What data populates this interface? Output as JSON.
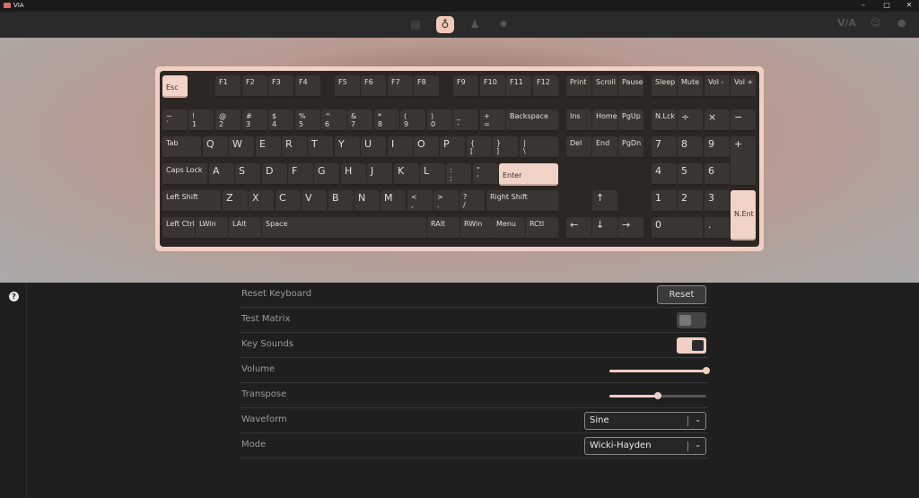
{
  "window": {
    "title": "VIA",
    "minimize": "–",
    "maximize": "□",
    "close": "✕"
  },
  "nav": {
    "icons": [
      "keyboard-icon",
      "stethoscope-icon",
      "design-icon",
      "gear-icon"
    ],
    "right": {
      "via_logo": "V/A",
      "discord": "☺",
      "github": "●"
    }
  },
  "colors": {
    "accent": "#f1cfc3",
    "keycap": "#3a3533",
    "board": "#2c2624"
  },
  "keyboard": {
    "keys": [
      [
        "esc",
        "Esc",
        "",
        181,
        84,
        28,
        25,
        true,
        false
      ],
      [
        "f1",
        "F1",
        "",
        240,
        84,
        28,
        25,
        false,
        false
      ],
      [
        "f2",
        "F2",
        "",
        270,
        84,
        28,
        25,
        false,
        false
      ],
      [
        "f3",
        "F3",
        "",
        299,
        84,
        28,
        25,
        false,
        false
      ],
      [
        "f4",
        "F4",
        "",
        329,
        84,
        28,
        25,
        false,
        false
      ],
      [
        "f5",
        "F5",
        "",
        373,
        84,
        28,
        25,
        false,
        false
      ],
      [
        "f6",
        "F6",
        "",
        402,
        84,
        28,
        25,
        false,
        false
      ],
      [
        "f7",
        "F7",
        "",
        432,
        84,
        28,
        25,
        false,
        false
      ],
      [
        "f8",
        "F8",
        "",
        461,
        84,
        28,
        25,
        false,
        false
      ],
      [
        "f9",
        "F9",
        "",
        505,
        84,
        28,
        25,
        false,
        false
      ],
      [
        "f10",
        "F10",
        "",
        535,
        84,
        28,
        25,
        false,
        false
      ],
      [
        "f11",
        "F11",
        "",
        564,
        84,
        28,
        25,
        false,
        false
      ],
      [
        "f12",
        "F12",
        "",
        594,
        84,
        28,
        25,
        false,
        false
      ],
      [
        "print",
        "Print",
        "",
        631,
        84,
        28,
        25,
        false,
        false
      ],
      [
        "scroll",
        "Scroll",
        "",
        660,
        84,
        28,
        25,
        false,
        false
      ],
      [
        "pause",
        "Pause",
        "",
        689,
        84,
        28,
        25,
        false,
        false
      ],
      [
        "sleep",
        "Sleep",
        "",
        726,
        84,
        28,
        25,
        false,
        false
      ],
      [
        "mute",
        "Mute",
        "",
        755,
        84,
        28,
        25,
        false,
        false
      ],
      [
        "vol-down",
        "Vol -",
        "",
        785,
        84,
        28,
        25,
        false,
        false
      ],
      [
        "vol-up",
        "Vol +",
        "",
        814,
        84,
        28,
        25,
        false,
        false
      ],
      [
        "grave",
        "~",
        "`",
        181,
        122,
        28,
        25,
        false,
        false
      ],
      [
        "1",
        "!",
        "1",
        210,
        122,
        28,
        25,
        false,
        false
      ],
      [
        "2",
        "@",
        "2",
        240,
        122,
        28,
        25,
        false,
        false
      ],
      [
        "3",
        "#",
        "3",
        270,
        122,
        28,
        25,
        false,
        false
      ],
      [
        "4",
        "$",
        "4",
        299,
        122,
        28,
        25,
        false,
        false
      ],
      [
        "5",
        "%",
        "5",
        329,
        122,
        28,
        25,
        false,
        false
      ],
      [
        "6",
        "^",
        "6",
        358,
        122,
        28,
        25,
        false,
        false
      ],
      [
        "7",
        "&",
        "7",
        387,
        122,
        28,
        25,
        false,
        false
      ],
      [
        "8",
        "*",
        "8",
        417,
        122,
        28,
        25,
        false,
        false
      ],
      [
        "9",
        "(",
        "9",
        446,
        122,
        28,
        25,
        false,
        false
      ],
      [
        "0",
        ")",
        "0",
        476,
        122,
        28,
        25,
        false,
        false
      ],
      [
        "minus",
        "_",
        "-",
        505,
        122,
        28,
        25,
        false,
        false
      ],
      [
        "equal",
        "+",
        "=",
        535,
        122,
        28,
        25,
        false,
        false
      ],
      [
        "backspace",
        "Backspace",
        "",
        564,
        122,
        58,
        25,
        false,
        false
      ],
      [
        "ins",
        "Ins",
        "",
        631,
        122,
        28,
        25,
        false,
        false
      ],
      [
        "home",
        "Home",
        "",
        660,
        122,
        28,
        25,
        false,
        false
      ],
      [
        "pgup",
        "PgUp",
        "",
        689,
        122,
        28,
        25,
        false,
        false
      ],
      [
        "numlock",
        "N.Lck",
        "",
        726,
        122,
        28,
        25,
        false,
        false
      ],
      [
        "num-div",
        "÷",
        "",
        755,
        122,
        28,
        25,
        false,
        true
      ],
      [
        "num-mul",
        "×",
        "",
        785,
        122,
        28,
        25,
        false,
        true
      ],
      [
        "num-sub",
        "−",
        "",
        814,
        122,
        28,
        25,
        false,
        true
      ],
      [
        "tab",
        "Tab",
        "",
        181,
        152,
        43,
        25,
        false,
        false
      ],
      [
        "q",
        "Q",
        "",
        226,
        152,
        28,
        25,
        false,
        true
      ],
      [
        "w",
        "W",
        "",
        255,
        152,
        28,
        25,
        false,
        true
      ],
      [
        "e",
        "E",
        "",
        285,
        152,
        28,
        25,
        false,
        true
      ],
      [
        "r",
        "R",
        "",
        314,
        152,
        28,
        25,
        false,
        true
      ],
      [
        "t",
        "T",
        "",
        343,
        152,
        28,
        25,
        false,
        true
      ],
      [
        "y",
        "Y",
        "",
        373,
        152,
        28,
        25,
        false,
        true
      ],
      [
        "u",
        "U",
        "",
        402,
        152,
        28,
        25,
        false,
        true
      ],
      [
        "i",
        "I",
        "",
        432,
        152,
        28,
        25,
        false,
        true
      ],
      [
        "o",
        "O",
        "",
        461,
        152,
        28,
        25,
        false,
        true
      ],
      [
        "p",
        "P",
        "",
        490,
        152,
        28,
        25,
        false,
        true
      ],
      [
        "lbracket",
        "{",
        "[",
        520,
        152,
        28,
        25,
        false,
        false
      ],
      [
        "rbracket",
        "}",
        "]",
        549,
        152,
        28,
        25,
        false,
        false
      ],
      [
        "backslash",
        "|",
        "\\",
        579,
        152,
        43,
        25,
        false,
        false
      ],
      [
        "del",
        "Del",
        "",
        631,
        152,
        28,
        25,
        false,
        false
      ],
      [
        "end",
        "End",
        "",
        660,
        152,
        28,
        25,
        false,
        false
      ],
      [
        "pgdn",
        "PgDn",
        "",
        689,
        152,
        28,
        25,
        false,
        false
      ],
      [
        "num7",
        "7",
        "",
        726,
        152,
        28,
        25,
        false,
        true
      ],
      [
        "num8",
        "8",
        "",
        755,
        152,
        28,
        25,
        false,
        true
      ],
      [
        "num9",
        "9",
        "",
        785,
        152,
        28,
        25,
        false,
        true
      ],
      [
        "num-add",
        "+",
        "",
        814,
        152,
        28,
        56,
        false,
        true
      ],
      [
        "capslock",
        "Caps Lock",
        "",
        181,
        182,
        50,
        25,
        false,
        false
      ],
      [
        "a",
        "A",
        "",
        233,
        182,
        28,
        25,
        false,
        true
      ],
      [
        "s",
        "S",
        "",
        262,
        182,
        28,
        25,
        false,
        true
      ],
      [
        "d",
        "D",
        "",
        292,
        182,
        28,
        25,
        false,
        true
      ],
      [
        "f",
        "F",
        "",
        321,
        182,
        28,
        25,
        false,
        true
      ],
      [
        "g",
        "G",
        "",
        350,
        182,
        28,
        25,
        false,
        true
      ],
      [
        "h",
        "H",
        "",
        380,
        182,
        28,
        25,
        false,
        true
      ],
      [
        "j",
        "J",
        "",
        409,
        182,
        28,
        25,
        false,
        true
      ],
      [
        "k",
        "K",
        "",
        439,
        182,
        28,
        25,
        false,
        true
      ],
      [
        "l",
        "L",
        "",
        468,
        182,
        28,
        25,
        false,
        true
      ],
      [
        "semicolon",
        ":",
        ";",
        497,
        182,
        28,
        25,
        false,
        false
      ],
      [
        "quote",
        "\"",
        "'",
        527,
        182,
        28,
        25,
        false,
        false
      ],
      [
        "enter",
        "Enter",
        "",
        556,
        182,
        66,
        25,
        true,
        false
      ],
      [
        "num4",
        "4",
        "",
        726,
        182,
        28,
        25,
        false,
        true
      ],
      [
        "num5",
        "5",
        "",
        755,
        182,
        28,
        25,
        false,
        true
      ],
      [
        "num6",
        "6",
        "",
        785,
        182,
        28,
        25,
        false,
        true
      ],
      [
        "lshift",
        "Left Shift",
        "",
        181,
        212,
        65,
        25,
        false,
        false
      ],
      [
        "z",
        "Z",
        "",
        248,
        212,
        28,
        25,
        false,
        true
      ],
      [
        "x",
        "X",
        "",
        277,
        212,
        28,
        25,
        false,
        true
      ],
      [
        "c",
        "C",
        "",
        307,
        212,
        28,
        25,
        false,
        true
      ],
      [
        "v",
        "V",
        "",
        336,
        212,
        28,
        25,
        false,
        true
      ],
      [
        "b",
        "B",
        "",
        366,
        212,
        28,
        25,
        false,
        true
      ],
      [
        "n",
        "N",
        "",
        395,
        212,
        28,
        25,
        false,
        true
      ],
      [
        "m",
        "M",
        "",
        424,
        212,
        28,
        25,
        false,
        true
      ],
      [
        "comma",
        "<",
        ",",
        454,
        212,
        28,
        25,
        false,
        false
      ],
      [
        "period",
        ">",
        ".",
        483,
        212,
        28,
        25,
        false,
        false
      ],
      [
        "slash",
        "?",
        "/",
        512,
        212,
        28,
        25,
        false,
        false
      ],
      [
        "rshift",
        "Right Shift",
        "",
        542,
        212,
        80,
        25,
        false,
        false
      ],
      [
        "up",
        "↑",
        "",
        660,
        212,
        28,
        25,
        false,
        true
      ],
      [
        "num1",
        "1",
        "",
        726,
        212,
        28,
        25,
        false,
        true
      ],
      [
        "num2",
        "2",
        "",
        755,
        212,
        28,
        25,
        false,
        true
      ],
      [
        "num3",
        "3",
        "",
        785,
        212,
        28,
        25,
        false,
        true
      ],
      [
        "num-enter",
        "N.Ent",
        "",
        814,
        212,
        28,
        56,
        true,
        false
      ],
      [
        "lctrl",
        "Left Ctrl",
        "",
        181,
        242,
        36,
        25,
        false,
        false
      ],
      [
        "lwin",
        "LWin",
        "",
        218,
        242,
        36,
        25,
        false,
        false
      ],
      [
        "lalt",
        "LAlt",
        "",
        255,
        242,
        36,
        25,
        false,
        false
      ],
      [
        "space",
        "Space",
        "",
        292,
        242,
        183,
        25,
        false,
        false
      ],
      [
        "ralt",
        "RAlt",
        "",
        476,
        242,
        36,
        25,
        false,
        false
      ],
      [
        "rwin",
        "RWin",
        "",
        513,
        242,
        36,
        25,
        false,
        false
      ],
      [
        "menu",
        "Menu",
        "",
        549,
        242,
        36,
        25,
        false,
        false
      ],
      [
        "rctrl",
        "RCtl",
        "",
        586,
        242,
        36,
        25,
        false,
        false
      ],
      [
        "left",
        "←",
        "",
        631,
        242,
        28,
        25,
        false,
        true
      ],
      [
        "down",
        "↓",
        "",
        660,
        242,
        28,
        25,
        false,
        true
      ],
      [
        "right",
        "→",
        "",
        689,
        242,
        28,
        25,
        false,
        true
      ],
      [
        "num0",
        "0",
        "",
        726,
        242,
        57,
        25,
        false,
        true
      ],
      [
        "num-dot",
        ".",
        "",
        785,
        242,
        28,
        25,
        false,
        true
      ]
    ]
  },
  "settings": {
    "reset_keyboard": {
      "label": "Reset Keyboard",
      "button": "Reset"
    },
    "test_matrix": {
      "label": "Test Matrix",
      "on": false
    },
    "key_sounds": {
      "label": "Key Sounds",
      "on": true
    },
    "volume": {
      "label": "Volume",
      "value": 1.0
    },
    "transpose": {
      "label": "Transpose",
      "value": 0.5
    },
    "waveform": {
      "label": "Waveform",
      "value": "Sine",
      "chevron": "⌄"
    },
    "mode": {
      "label": "Mode",
      "value": "Wicki-Hayden",
      "chevron": "⌄"
    }
  },
  "sidebar": {
    "help": "?"
  }
}
